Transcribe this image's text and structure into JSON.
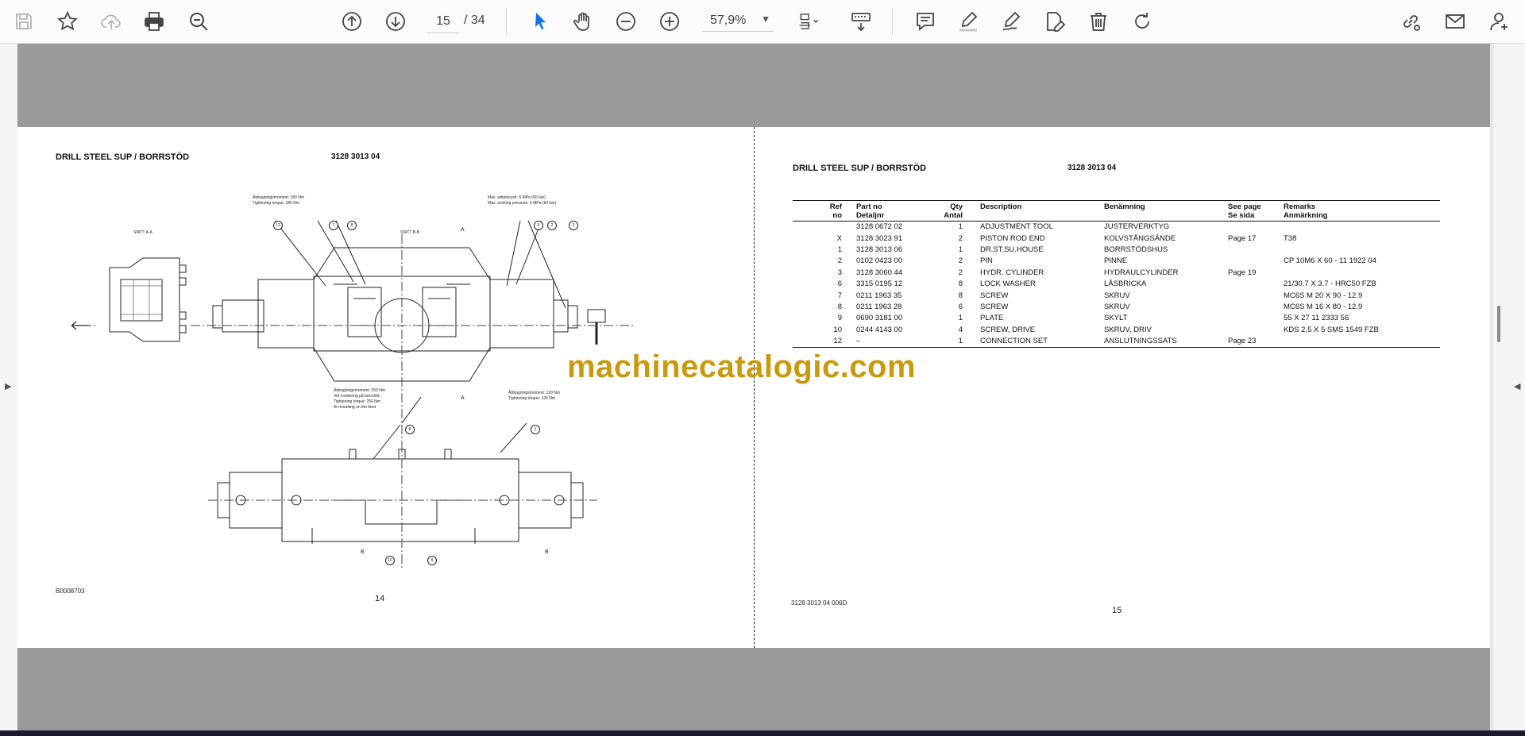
{
  "toolbar": {
    "page_current": "15",
    "page_total": "/ 34",
    "zoom": "57,9%",
    "icons": [
      "save-icon",
      "star-icon",
      "cloud-upload-icon",
      "print-icon",
      "zoom-search-icon",
      "arrow-up-icon",
      "arrow-down-icon",
      "select-cursor-icon",
      "hand-icon",
      "zoom-out-icon",
      "zoom-in-icon",
      "page-fit-icon",
      "scroll-mode-icon",
      "comment-icon",
      "highlight-icon",
      "draw-icon",
      "edit-icon",
      "delete-icon",
      "rotate-icon",
      "share-link-icon",
      "mail-icon",
      "account-icon"
    ]
  },
  "left_page": {
    "title": "DRILL STEEL SUP / BORRSTÖD",
    "part_number": "3128 3013 04",
    "drawing_ref": "B0008703",
    "page_number": "14",
    "drawing_labels": {
      "section_aa": "SNITT A-A",
      "section_bb": "SNITT B-B",
      "note_tl1": "Åtdragningsmoment: 180 Nm",
      "note_tl2": "Tightening torque: 180 Nm",
      "note_tr1": "Max. arbetstryck: 6 MPa (60 bar)",
      "note_tr2": "Max. working pressure: 6 MPa (60 bar)",
      "note_bl1": "Åtdragningsmoment: 250 Nm",
      "note_bl2": "Vid montering på borrstöd",
      "note_bl3": "Tightening torque: 250 Nm",
      "note_bl4": "At mounting on the feed",
      "note_br1": "Åtdragningsmoment: 120 Nm",
      "note_br2": "Tightening torque: 120 Nm",
      "balloons": [
        "12",
        "7",
        "8",
        "6",
        "2",
        "3",
        "8",
        "1",
        "10",
        "9"
      ],
      "section_letters": [
        "A",
        "A",
        "B",
        "B"
      ]
    }
  },
  "right_page": {
    "title": "DRILL STEEL SUP / BORRSTÖD",
    "part_number": "3128 3013 04",
    "footer_ref": "3128 3013 04  006D",
    "page_number": "15",
    "headers": {
      "ref": "Ref",
      "ref2": "no",
      "part": "Part no",
      "part2": "Detaljnr",
      "qty": "Qty",
      "qty2": "Antal",
      "desc": "Description",
      "desc2": "",
      "ben": "Benämning",
      "ben2": "",
      "see": "See page",
      "see2": "Se sida",
      "rem": "Remarks",
      "rem2": "Anmärkning"
    },
    "rows": [
      {
        "ref": "",
        "part": "3128 0672 02",
        "qty": "1",
        "desc": "ADJUSTMENT TOOL",
        "ben": "JUSTERVERKTYG",
        "see": "",
        "rem": ""
      },
      {
        "ref": "X",
        "part": "3128 3023 91",
        "qty": "2",
        "desc": "PISTON ROD END",
        "ben": "KOLVSTÅNGSÄNDE",
        "see": "Page 17",
        "rem": "T38"
      },
      {
        "ref": "1",
        "part": "3128 3013 06",
        "qty": "1",
        "desc": "DR.ST.SU.HOUSE",
        "ben": "BORRSTÖDSHUS",
        "see": "",
        "rem": ""
      },
      {
        "ref": "2",
        "part": "0102 0423 00",
        "qty": "2",
        "desc": "PIN",
        "ben": "PINNE",
        "see": "",
        "rem": "CP 10M6 X 60 - 11 1922 04"
      },
      {
        "ref": "3",
        "part": "3128 3060 44",
        "qty": "2",
        "desc": "HYDR. CYLINDER",
        "ben": "HYDRAULCYLINDER",
        "see": "Page 19",
        "rem": ""
      },
      {
        "ref": "6",
        "part": "3315 0195 12",
        "qty": "8",
        "desc": "LOCK WASHER",
        "ben": "LÅSBRICKA",
        "see": "",
        "rem": "21/30.7 X 3.7 - HRC50 FZB"
      },
      {
        "ref": "7",
        "part": "0211 1963 35",
        "qty": "8",
        "desc": "SCREW",
        "ben": "SKRUV",
        "see": "",
        "rem": "MC6S M 20 X 90 - 12.9"
      },
      {
        "ref": "8",
        "part": "0211 1963 28",
        "qty": "6",
        "desc": "SCREW",
        "ben": "SKRUV",
        "see": "",
        "rem": "MC6S M 16 X 80 - 12.9"
      },
      {
        "ref": "9",
        "part": "0690 3181 00",
        "qty": "1",
        "desc": "PLATE",
        "ben": "SKYLT",
        "see": "",
        "rem": "55 X 27 11 2333 56"
      },
      {
        "ref": "10",
        "part": "0244 4143 00",
        "qty": "4",
        "desc": "SCREW, DRIVE",
        "ben": "SKRUV, DRIV",
        "see": "",
        "rem": "KDS 2,5 X 5 SMS 1549 FZB"
      },
      {
        "ref": "12",
        "part": "–",
        "qty": "1",
        "desc": "CONNECTION SET",
        "ben": "ANSLUTNINGSSATS",
        "see": "Page 23",
        "rem": ""
      }
    ]
  },
  "watermark": "machinecatalogic.com",
  "colors": {
    "viewer_bg": "#9a9a9a",
    "toolbar_bg": "#fbfbfb",
    "select_tool": "#1473e6",
    "watermark": "#c89a10"
  }
}
